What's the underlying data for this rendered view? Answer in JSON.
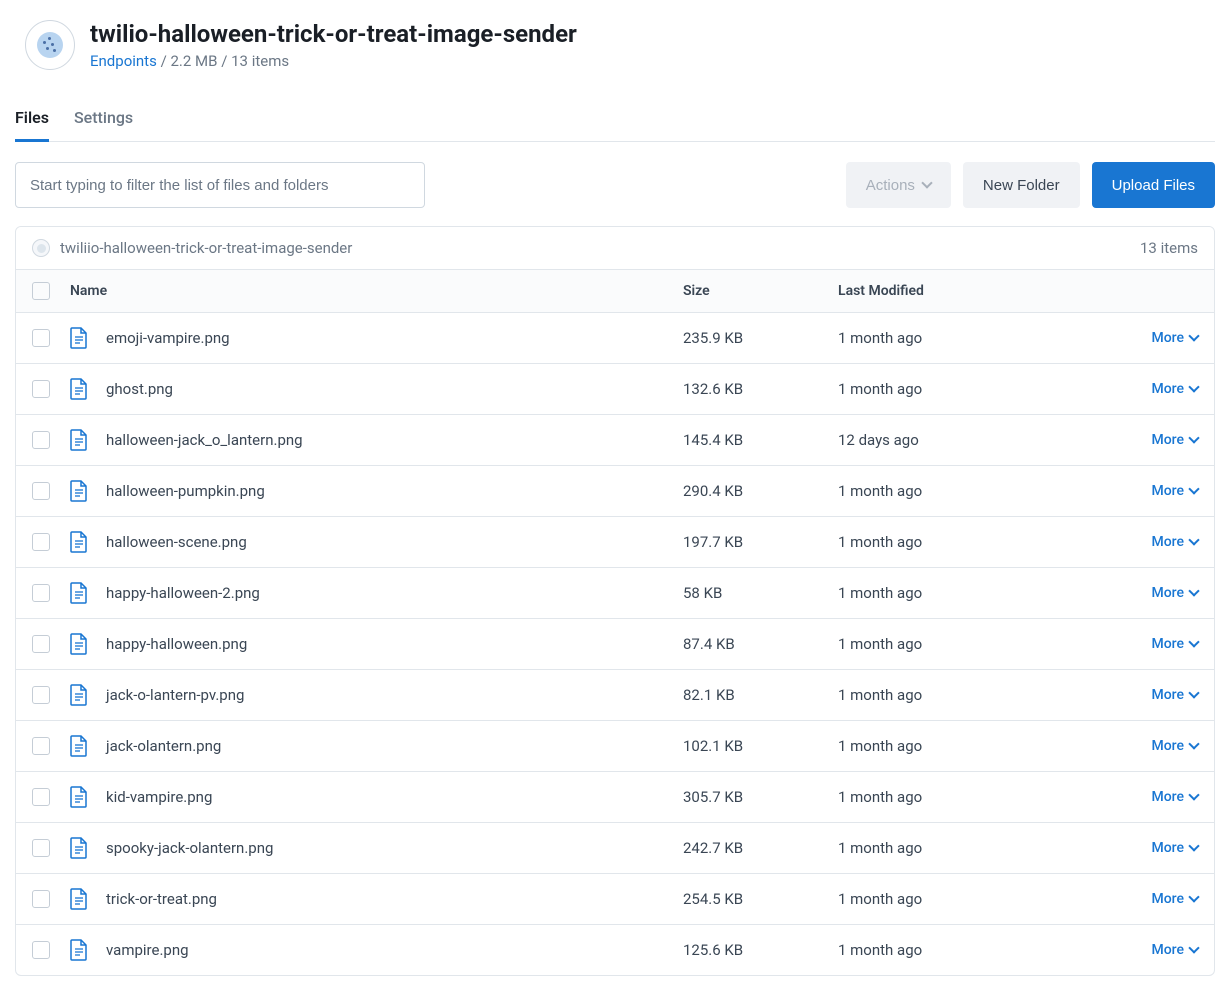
{
  "header": {
    "title": "twilio-halloween-trick-or-treat-image-sender",
    "breadcrumb_link": "Endpoints",
    "breadcrumb_size": "2.2 MB",
    "breadcrumb_count": "13 items"
  },
  "tabs": {
    "files": "Files",
    "settings": "Settings"
  },
  "toolbar": {
    "filter_placeholder": "Start typing to filter the list of files and folders",
    "actions": "Actions",
    "new_folder": "New Folder",
    "upload": "Upload Files"
  },
  "panel": {
    "path": "twiliio-halloween-trick-or-treat-image-sender",
    "count": "13 items"
  },
  "columns": {
    "name": "Name",
    "size": "Size",
    "modified": "Last Modified"
  },
  "more_label": "More",
  "files": [
    {
      "name": "emoji-vampire.png",
      "size": "235.9 KB",
      "modified": "1 month ago"
    },
    {
      "name": "ghost.png",
      "size": "132.6 KB",
      "modified": "1 month ago"
    },
    {
      "name": "halloween-jack_o_lantern.png",
      "size": "145.4 KB",
      "modified": "12 days ago"
    },
    {
      "name": "halloween-pumpkin.png",
      "size": "290.4 KB",
      "modified": "1 month ago"
    },
    {
      "name": "halloween-scene.png",
      "size": "197.7 KB",
      "modified": "1 month ago"
    },
    {
      "name": "happy-halloween-2.png",
      "size": "58 KB",
      "modified": "1 month ago"
    },
    {
      "name": "happy-halloween.png",
      "size": "87.4 KB",
      "modified": "1 month ago"
    },
    {
      "name": "jack-o-lantern-pv.png",
      "size": "82.1 KB",
      "modified": "1 month ago"
    },
    {
      "name": "jack-olantern.png",
      "size": "102.1 KB",
      "modified": "1 month ago"
    },
    {
      "name": "kid-vampire.png",
      "size": "305.7 KB",
      "modified": "1 month ago"
    },
    {
      "name": "spooky-jack-olantern.png",
      "size": "242.7 KB",
      "modified": "1 month ago"
    },
    {
      "name": "trick-or-treat.png",
      "size": "254.5 KB",
      "modified": "1 month ago"
    },
    {
      "name": "vampire.png",
      "size": "125.6 KB",
      "modified": "1 month ago"
    }
  ]
}
